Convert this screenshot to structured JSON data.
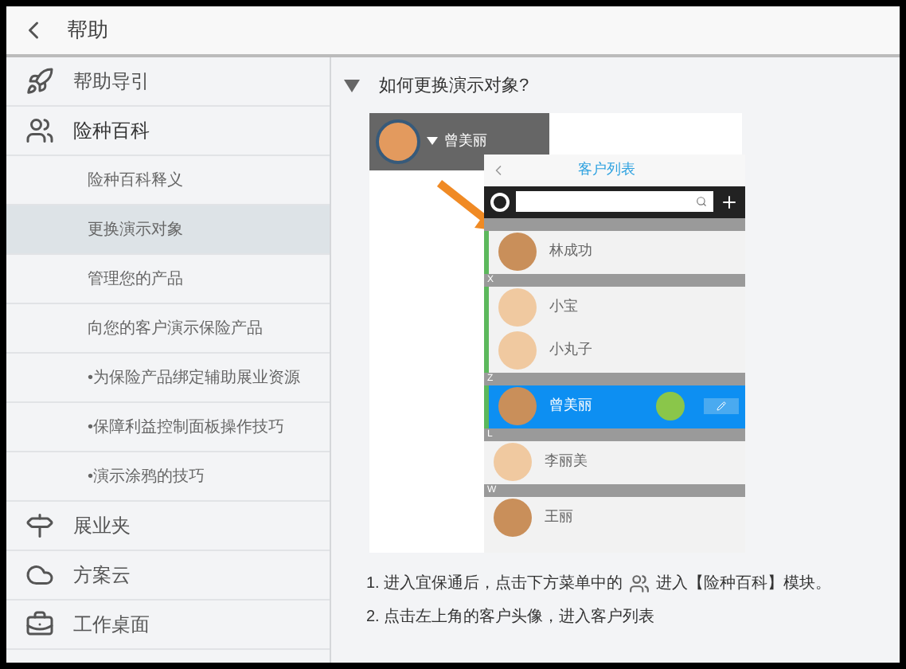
{
  "header": {
    "title": "帮助"
  },
  "sidebar": {
    "items": [
      {
        "label": "帮助导引",
        "expanded": false
      },
      {
        "label": "险种百科",
        "expanded": true,
        "children": [
          {
            "label": "险种百科释义",
            "selected": false
          },
          {
            "label": "更换演示对象",
            "selected": true
          },
          {
            "label": "管理您的产品",
            "selected": false
          },
          {
            "label": "向您的客户演示保险产品",
            "selected": false
          },
          {
            "label": "•为保险产品绑定辅助展业资源",
            "selected": false
          },
          {
            "label": "•保障利益控制面板操作技巧",
            "selected": false
          },
          {
            "label": "•演示涂鸦的技巧",
            "selected": false
          }
        ]
      },
      {
        "label": "展业夹",
        "expanded": false
      },
      {
        "label": "方案云",
        "expanded": false
      },
      {
        "label": "工作桌面",
        "expanded": false
      }
    ]
  },
  "content": {
    "question": "如何更换演示对象?",
    "expanded": true,
    "screenshot": {
      "profile_name": "曾美丽",
      "list_title": "客户列表",
      "groups": [
        {
          "contacts": [
            {
              "name": "林成功",
              "selected": false
            }
          ]
        },
        {
          "letter": "X",
          "contacts": [
            {
              "name": "小宝",
              "selected": false
            },
            {
              "name": "小丸子",
              "selected": false
            }
          ]
        },
        {
          "letter": "Z",
          "contacts": [
            {
              "name": "曾美丽",
              "selected": true
            }
          ]
        },
        {
          "letter": "L",
          "contacts": [
            {
              "name": "李丽美",
              "selected": false
            }
          ]
        },
        {
          "letter": "W",
          "contacts": [
            {
              "name": "王丽",
              "selected": false
            }
          ]
        }
      ]
    },
    "steps": [
      {
        "before": "1. 进入宜保通后，点击下方菜单中的",
        "after": "进入【险种百科】模块。"
      },
      {
        "before": "2. 点击左上角的客户头像，进入客户列表"
      }
    ]
  }
}
